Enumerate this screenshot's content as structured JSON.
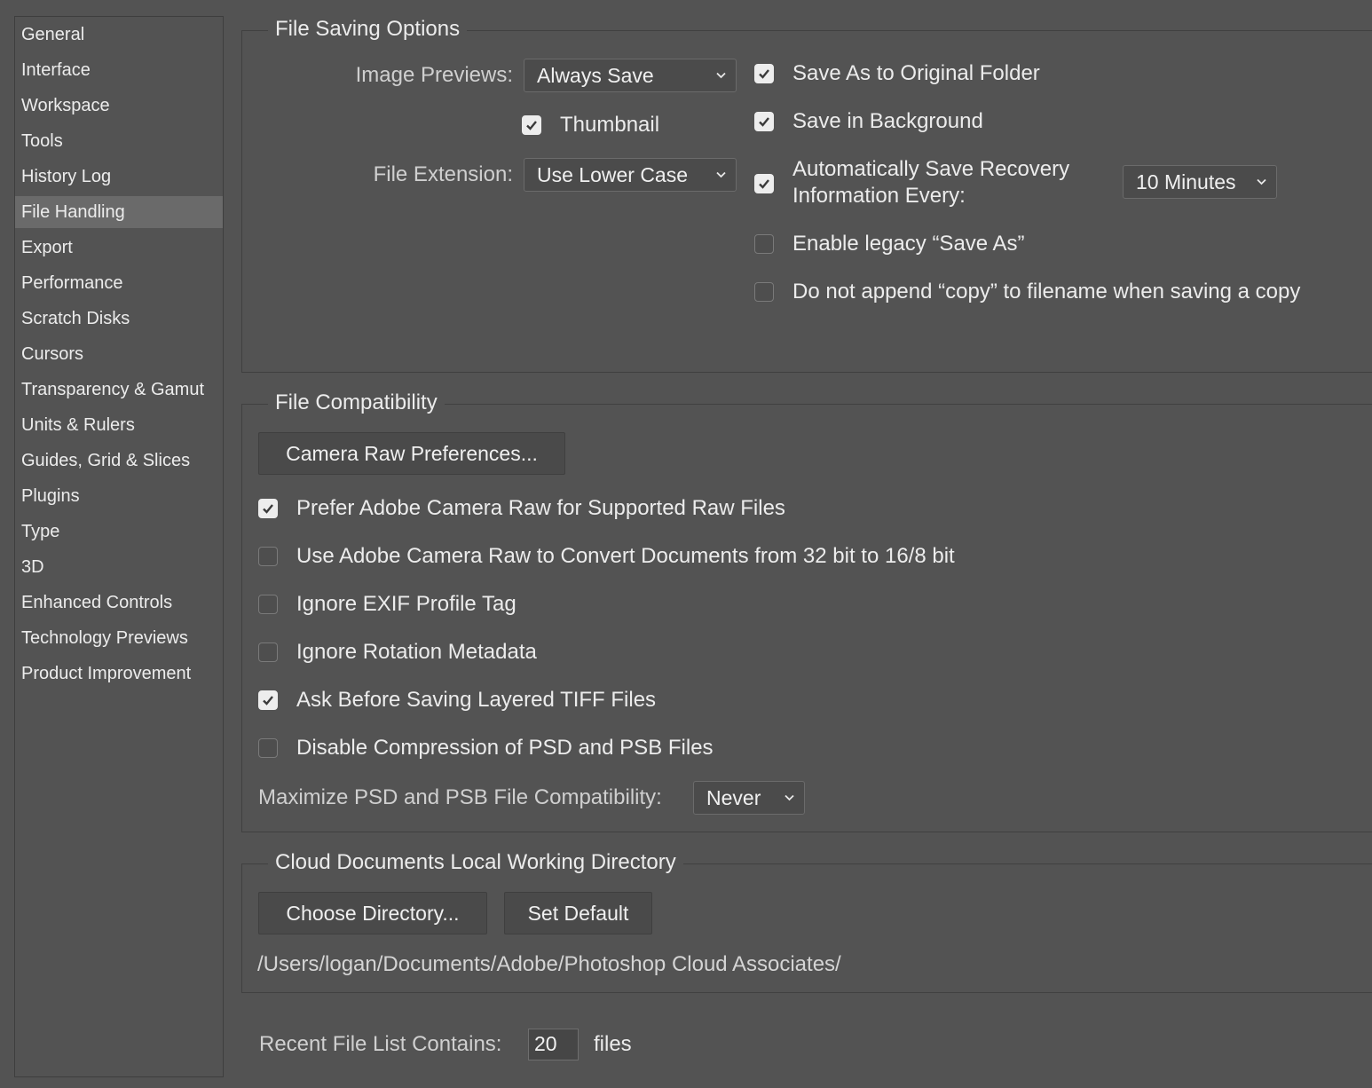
{
  "sidebar": {
    "items": [
      {
        "label": "General"
      },
      {
        "label": "Interface"
      },
      {
        "label": "Workspace"
      },
      {
        "label": "Tools"
      },
      {
        "label": "History Log"
      },
      {
        "label": "File Handling",
        "selected": true
      },
      {
        "label": "Export"
      },
      {
        "label": "Performance"
      },
      {
        "label": "Scratch Disks"
      },
      {
        "label": "Cursors"
      },
      {
        "label": "Transparency & Gamut"
      },
      {
        "label": "Units & Rulers"
      },
      {
        "label": "Guides, Grid & Slices"
      },
      {
        "label": "Plugins"
      },
      {
        "label": "Type"
      },
      {
        "label": "3D"
      },
      {
        "label": "Enhanced Controls"
      },
      {
        "label": "Technology Previews"
      },
      {
        "label": "Product Improvement"
      }
    ]
  },
  "file_saving": {
    "title": "File Saving Options",
    "image_previews_label": "Image Previews:",
    "image_previews_value": "Always Save",
    "thumbnail_label": "Thumbnail",
    "thumbnail_checked": true,
    "file_extension_label": "File Extension:",
    "file_extension_value": "Use Lower Case",
    "save_as_original_label": "Save As to Original Folder",
    "save_as_original_checked": true,
    "save_background_label": "Save in Background",
    "save_background_checked": true,
    "auto_save_label_line1": "Automatically Save Recovery",
    "auto_save_label_line2": "Information Every:",
    "auto_save_checked": true,
    "auto_save_interval": "10 Minutes",
    "legacy_save_as_label": "Enable legacy “Save As”",
    "legacy_save_as_checked": false,
    "no_copy_label": "Do not append “copy” to filename when saving a copy",
    "no_copy_checked": false
  },
  "file_compat": {
    "title": "File Compatibility",
    "camera_raw_button": "Camera Raw Preferences...",
    "options": [
      {
        "label": "Prefer Adobe Camera Raw for Supported Raw Files",
        "checked": true
      },
      {
        "label": "Use Adobe Camera Raw to Convert Documents from 32 bit to 16/8 bit",
        "checked": false
      },
      {
        "label": "Ignore EXIF Profile Tag",
        "checked": false
      },
      {
        "label": "Ignore Rotation Metadata",
        "checked": false
      },
      {
        "label": "Ask Before Saving Layered TIFF Files",
        "checked": true
      },
      {
        "label": "Disable Compression of PSD and PSB Files",
        "checked": false
      }
    ],
    "maximize_label": "Maximize PSD and PSB File Compatibility:",
    "maximize_value": "Never"
  },
  "cloud_docs": {
    "title": "Cloud Documents Local Working Directory",
    "choose_button": "Choose Directory...",
    "default_button": "Set Default",
    "path": "/Users/logan/Documents/Adobe/Photoshop Cloud Associates/"
  },
  "recent": {
    "label": "Recent File List Contains:",
    "value": "20",
    "suffix": "files"
  }
}
